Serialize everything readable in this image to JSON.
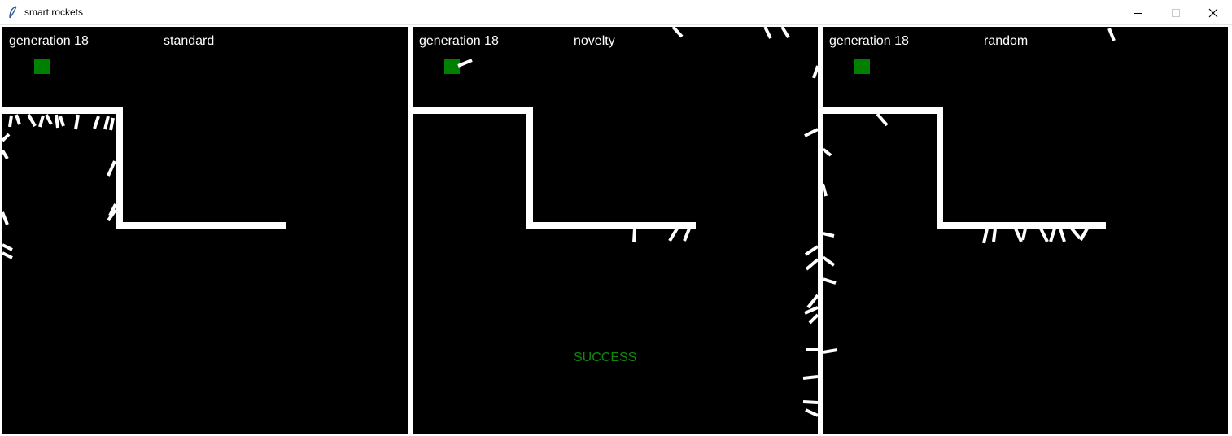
{
  "window": {
    "title": "smart rockets",
    "app_icon": "feather-icon",
    "controls": [
      "minimize-icon",
      "maximize-icon",
      "close-icon"
    ]
  },
  "colors": {
    "background": "#000000",
    "wall": "#ffffff",
    "target": "#008000",
    "rocket": "#ffffff",
    "success": "#0d8a0d"
  },
  "panels": [
    {
      "generation_label": "generation 18",
      "mode": "standard",
      "status": ""
    },
    {
      "generation_label": "generation 18",
      "mode": "novelty",
      "status": "SUCCESS"
    },
    {
      "generation_label": "generation 18",
      "mode": "random",
      "status": ""
    }
  ]
}
